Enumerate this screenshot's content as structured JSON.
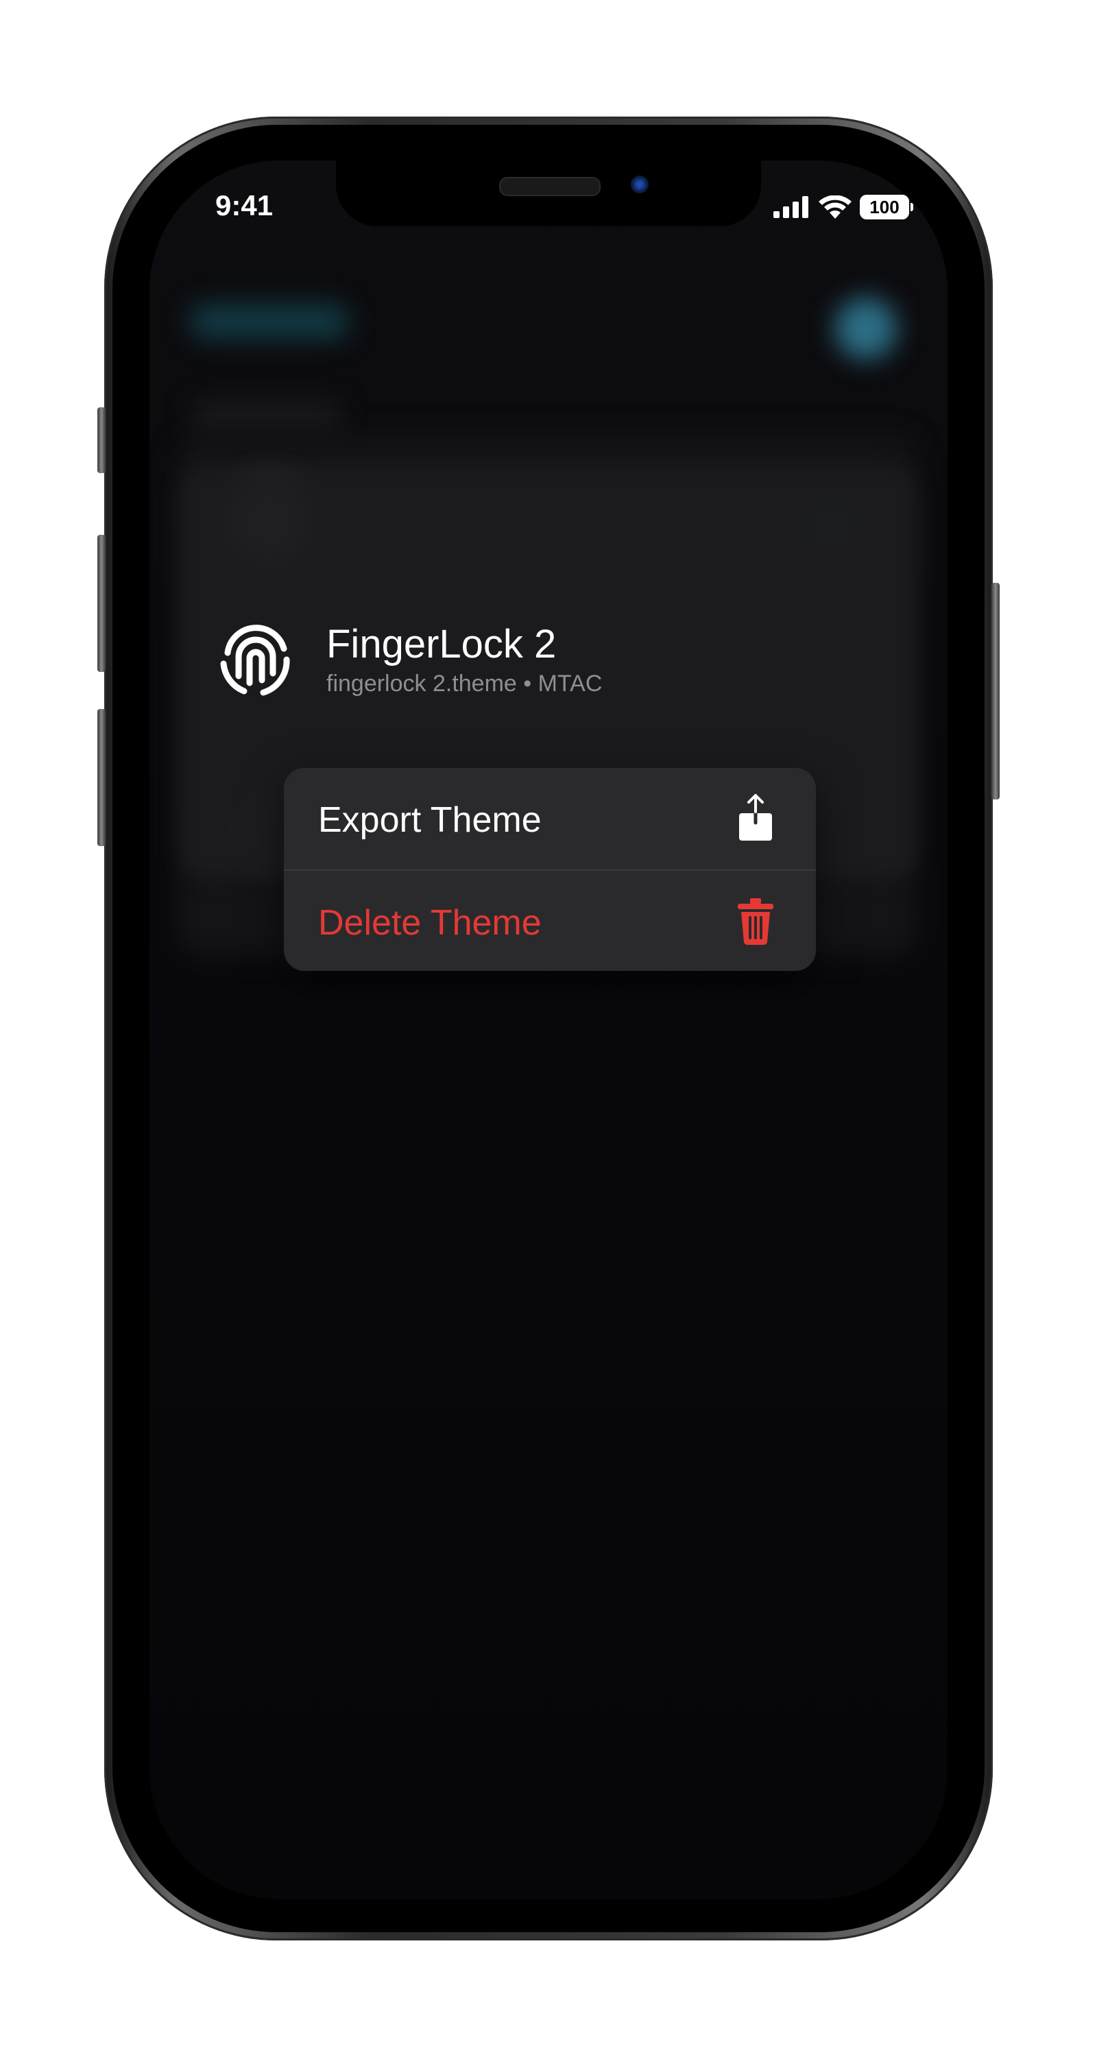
{
  "status_bar": {
    "time": "9:41",
    "battery": "100"
  },
  "theme": {
    "name": "FingerLock 2",
    "subtitle": "fingerlock 2.theme • MTAC",
    "icon": "fingerprint-icon"
  },
  "context_menu": {
    "items": [
      {
        "label": "Export Theme",
        "icon": "share-icon",
        "color": "#ffffff"
      },
      {
        "label": "Delete Theme",
        "icon": "trash-icon",
        "color": "#e53935"
      }
    ]
  },
  "colors": {
    "destructive": "#e53935",
    "accent_blurred": "#2c6f86"
  }
}
